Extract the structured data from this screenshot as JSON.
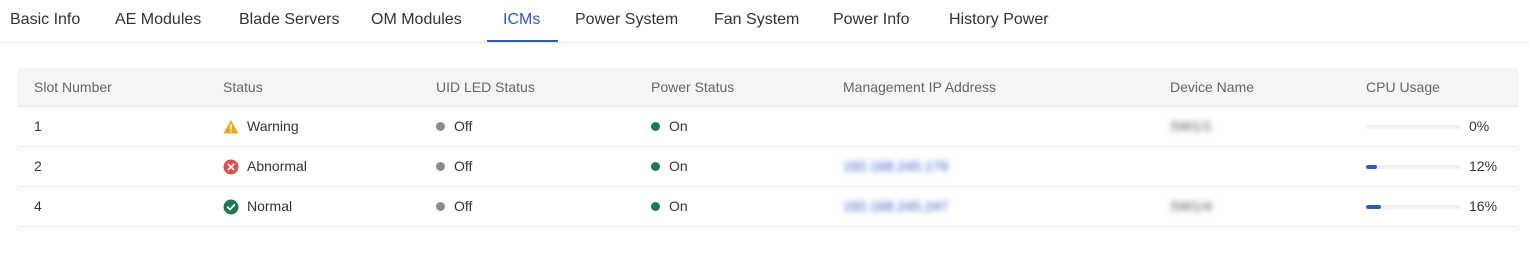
{
  "tabs": [
    {
      "label": "Basic Info"
    },
    {
      "label": "AE Modules"
    },
    {
      "label": "Blade Servers"
    },
    {
      "label": "OM Modules"
    },
    {
      "label": "ICMs",
      "active": true
    },
    {
      "label": "Power System"
    },
    {
      "label": "Fan System"
    },
    {
      "label": "Power Info"
    },
    {
      "label": "History Power"
    }
  ],
  "table": {
    "columns": [
      "Slot Number",
      "Status",
      "UID LED Status",
      "Power Status",
      "Management IP Address",
      "Device Name",
      "CPU Usage"
    ],
    "rows": [
      {
        "slot": "1",
        "status": "Warning",
        "status_icon": "warning-icon",
        "uid_led": "Off",
        "power": "On",
        "ip": "",
        "device_name": "SW1/1",
        "cpu_text": "0%",
        "cpu_fraction": 0.0
      },
      {
        "slot": "2",
        "status": "Abnormal",
        "status_icon": "error-icon",
        "uid_led": "Off",
        "power": "On",
        "ip": "192.168.245.179",
        "device_name": "",
        "cpu_text": "12%",
        "cpu_fraction": 0.12
      },
      {
        "slot": "4",
        "status": "Normal",
        "status_icon": "check-icon",
        "uid_led": "Off",
        "power": "On",
        "ip": "192.168.245.247",
        "device_name": "SW1/4",
        "cpu_text": "16%",
        "cpu_fraction": 0.16
      }
    ]
  },
  "colors": {
    "accent": "#2d59c2",
    "warning": "#f0a51e",
    "error": "#d9534f",
    "success": "#1e7a52",
    "led_off": "#8a8d94"
  }
}
